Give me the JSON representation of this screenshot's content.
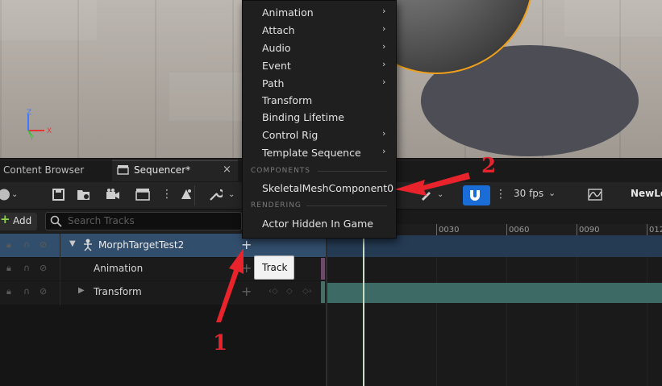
{
  "tabs": {
    "content_browser": "Content Browser",
    "sequencer": "Sequencer*",
    "close": "×"
  },
  "toolbar": {
    "fps": "30 fps",
    "fps_chevron": "⌄",
    "sequence_name": "NewLe",
    "dots": "⋮"
  },
  "tracks_panel": {
    "add_label": "Add",
    "add_plus": "+",
    "search_placeholder": "Search Tracks",
    "rows": [
      {
        "label": "MorphTargetTest2",
        "expand": "▼",
        "plus": "+"
      },
      {
        "label": "Animation",
        "plus": "+"
      },
      {
        "label": "Transform",
        "expand": "▶",
        "plus": "+"
      }
    ],
    "tooltip": "Track"
  },
  "timeline": {
    "ticks": [
      "0030",
      "0060",
      "0090",
      "012"
    ]
  },
  "menu": {
    "items": [
      {
        "label": "Animation",
        "arrow": "›"
      },
      {
        "label": "Attach",
        "arrow": "›"
      },
      {
        "label": "Audio",
        "arrow": "›"
      },
      {
        "label": "Event",
        "arrow": "›"
      },
      {
        "label": "Path",
        "arrow": "›"
      },
      {
        "label": "Transform"
      },
      {
        "label": "Binding Lifetime"
      },
      {
        "label": "Control Rig",
        "arrow": "›"
      },
      {
        "label": "Template Sequence",
        "arrow": "›"
      }
    ],
    "components_heading": "COMPONENTS",
    "component_item": "SkeletalMeshComponent0",
    "rendering_heading": "RENDERING",
    "rendering_item": "Actor Hidden In Game"
  },
  "viewport": {
    "axis_z": "Z",
    "axis_x": "X",
    "axis_y": "Y"
  },
  "annotations": {
    "callout_1": "1",
    "callout_2": "2",
    "color": "#e8232b"
  },
  "colors": {
    "accent_blue": "#1a6dd6",
    "selected_row": "#324e6d",
    "transform_track": "#3d6a64"
  }
}
